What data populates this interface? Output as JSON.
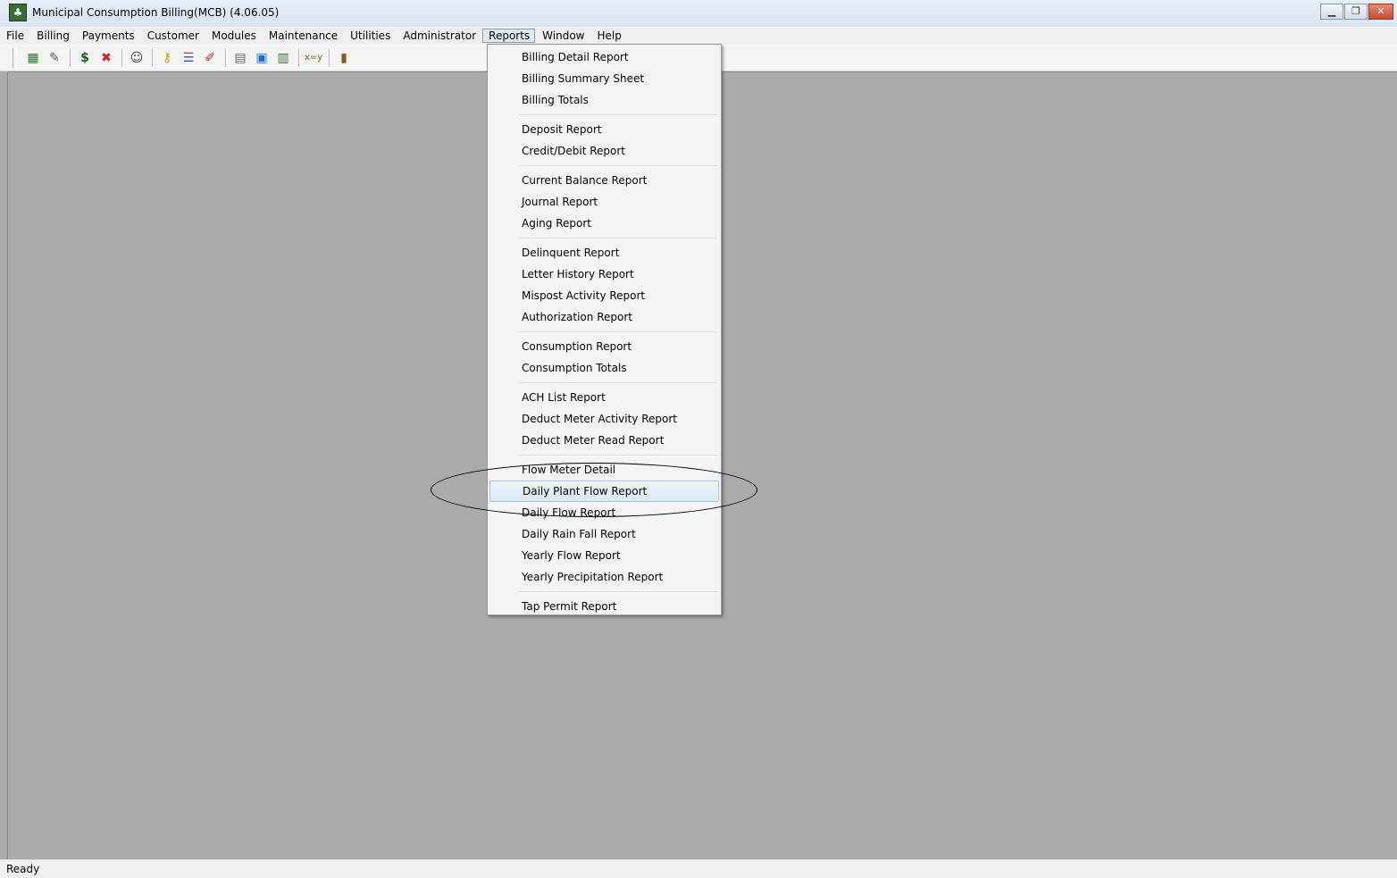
{
  "window": {
    "title": "Municipal Consumption Billing(MCB)  (4.06.05)",
    "controls": [
      "minimize-icon",
      "restore-icon",
      "close-icon"
    ]
  },
  "menubar": {
    "items": [
      "File",
      "Billing",
      "Payments",
      "Customer",
      "Modules",
      "Maintenance",
      "Utilities",
      "Administrator",
      "Reports",
      "Window",
      "Help"
    ],
    "active": "Reports"
  },
  "toolbar": {
    "groups": [
      [
        "calendar-icon",
        "edit-document-icon"
      ],
      [
        "dollar-icon",
        "stop-icon"
      ],
      [
        "user-search-icon"
      ],
      [
        "key-icon",
        "stack-icon",
        "pen-icon"
      ],
      [
        "clipboard-icon",
        "document-icon",
        "calendar-grid-icon"
      ],
      [
        "variable-icon"
      ],
      [
        "exit-door-icon"
      ]
    ]
  },
  "reports_menu": {
    "groups": [
      [
        "Billing Detail Report",
        "Billing Summary Sheet",
        "Billing Totals"
      ],
      [
        "Deposit Report",
        "Credit/Debit Report"
      ],
      [
        "Current Balance Report",
        "Journal Report",
        "Aging Report"
      ],
      [
        "Delinquent Report",
        "Letter History Report",
        "Mispost Activity Report",
        "Authorization Report"
      ],
      [
        "Consumption Report",
        "Consumption Totals"
      ],
      [
        "ACH List Report",
        "Deduct Meter Activity Report",
        "Deduct Meter Read Report"
      ],
      [
        "Flow Meter Detail",
        "Daily Plant Flow Report",
        "Daily Flow Report",
        "Daily Rain Fall Report",
        "Yearly Flow Report",
        "Yearly Precipitation Report"
      ],
      [
        "Tap Permit Report"
      ]
    ],
    "highlighted": "Daily Plant Flow Report"
  },
  "statusbar": {
    "text": "Ready"
  }
}
